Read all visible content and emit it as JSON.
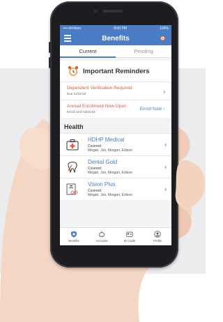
{
  "status_bar": {
    "carrier": "•••• InVision",
    "time": "8:00 PM",
    "battery": "100%"
  },
  "header": {
    "title": "Benefits"
  },
  "tabs": [
    {
      "label": "Current"
    },
    {
      "label": "Pending"
    }
  ],
  "reminders": {
    "title": "Important Reminders",
    "items": [
      {
        "title": "Dependent Verification Required",
        "subtitle": "Due 12/31/18"
      },
      {
        "title": "Annual Enrollment Now Open",
        "subtitle": "Enroll Until 12/31/18",
        "action": "Enroll Now"
      }
    ]
  },
  "health": {
    "title": "Health",
    "plans": [
      {
        "name": "HDHP Medical",
        "status": "Covered",
        "members": "Megan, Jon, Morgan, Edison"
      },
      {
        "name": "Dental Gold",
        "status": "Covered",
        "members": "Megan, Jon, Morgan, Edison"
      },
      {
        "name": "Vision Plus",
        "status": "Covered",
        "members": "Megan, Jon, Morgan, Edison"
      }
    ]
  },
  "bottom_tabs": [
    {
      "label": "Benefits"
    },
    {
      "label": "Accounts"
    },
    {
      "label": "ID Cards"
    },
    {
      "label": "Profile"
    }
  ],
  "colors": {
    "brand_blue": "#4a7dc6",
    "alert_red": "#e05a3a",
    "phone_body": "#1c1d20"
  }
}
